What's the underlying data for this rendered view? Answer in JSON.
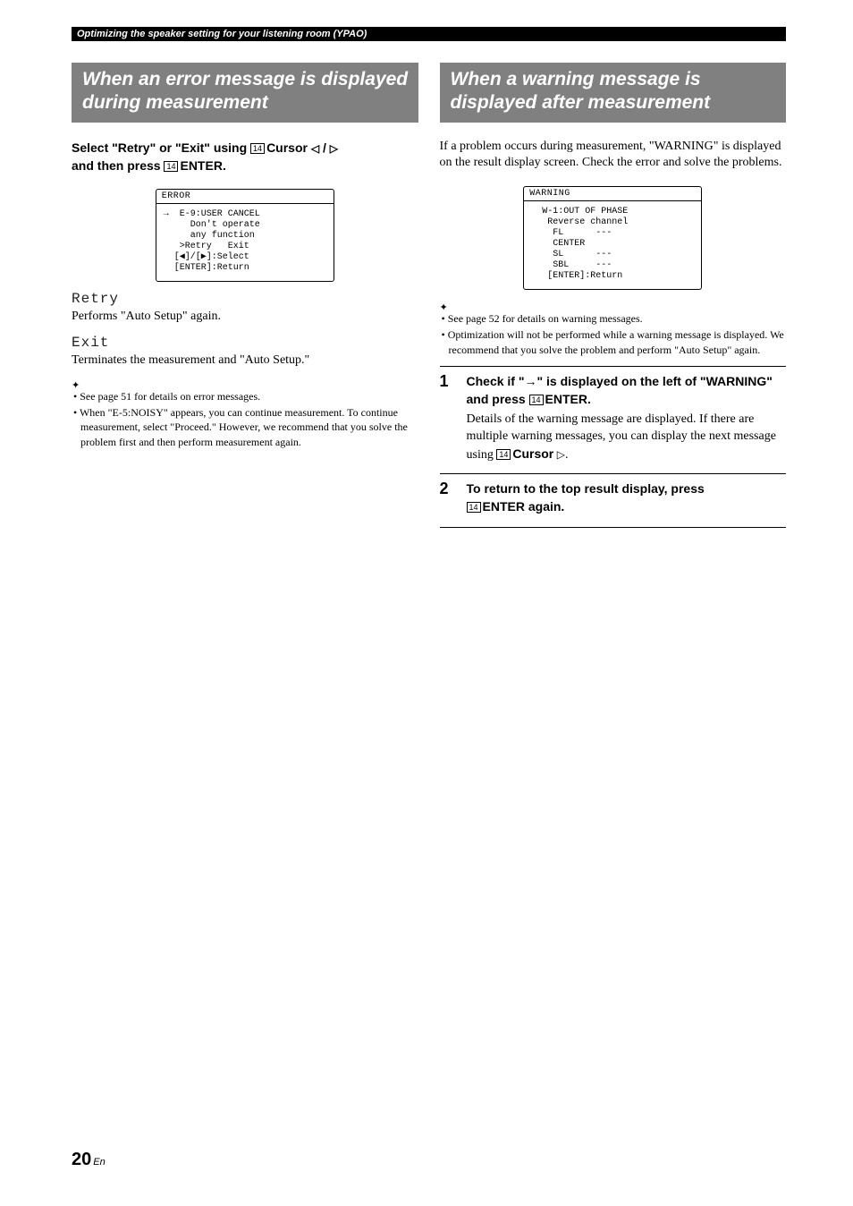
{
  "topbar": "Optimizing the speaker setting for your listening room (YPAO)",
  "left": {
    "heading": "When an error message is displayed during measurement",
    "instruction_parts": {
      "p1": "Select \"Retry\" or \"Exit\" using ",
      "cursor": "Cursor",
      "slash": " / ",
      "p2": "and then press ",
      "enter": "ENTER",
      "period": "."
    },
    "screen": {
      "title": "ERROR",
      "lines": [
        "→  E-9:USER CANCEL",
        "     Don't operate",
        "     any function",
        "",
        "   >Retry   Exit",
        "",
        "  [◀]/[▶]:Select",
        "  [ENTER]:Return"
      ]
    },
    "retry": {
      "name": "Retry",
      "desc": "Performs \"Auto Setup\" again."
    },
    "exit": {
      "name": "Exit",
      "desc": "Terminates the measurement and \"Auto Setup.\""
    },
    "notes": [
      "See page 51 for details on error messages.",
      "When \"E-5:NOISY\" appears, you can continue measurement. To continue measurement, select \"Proceed.\" However, we recommend that you solve the problem first and then perform measurement again."
    ]
  },
  "right": {
    "heading": "When a warning message is displayed after measurement",
    "intro": "If a problem occurs during measurement, \"WARNING\" is displayed on the result display screen. Check the error and solve the problems.",
    "screen": {
      "title": "WARNING",
      "lines": [
        "  W-1:OUT OF PHASE",
        "   Reverse channel",
        "    FL      ---",
        "    CENTER",
        "    SL      ---",
        "    SBL     ---",
        "",
        "   [ENTER]:Return"
      ]
    },
    "notes": [
      "See page 52 for details on warning messages.",
      "Optimization will not be performed while a warning message is displayed. We recommend that you solve the problem and perform \"Auto Setup\" again."
    ],
    "step1": {
      "title_parts": {
        "p1": "Check if \"→\" is displayed on the left of \"WARNING\" and press ",
        "enter": "ENTER",
        "period": "."
      },
      "desc_parts": {
        "p1": "Details of the warning message are displayed. If there are multiple warning messages, you can display the next message using ",
        "cursor": "Cursor",
        "period": "."
      }
    },
    "step2": {
      "title_parts": {
        "p1": "To return to the top result display, press ",
        "enter": "ENTER",
        "p2": " again."
      }
    }
  },
  "page": {
    "num": "20",
    "suffix": "En"
  },
  "key14": "14"
}
